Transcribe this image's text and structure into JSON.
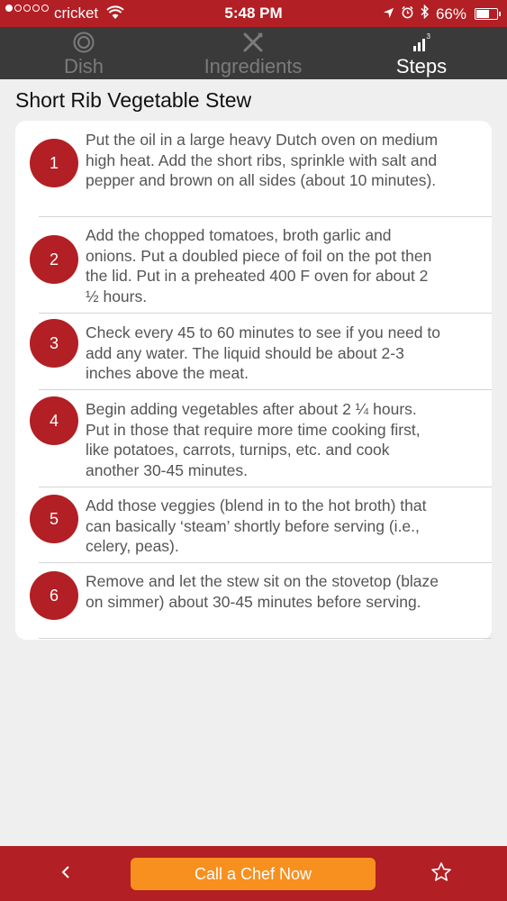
{
  "status_bar": {
    "signal_dots_filled": 1,
    "signal_dots_total": 5,
    "carrier": "cricket",
    "time": "5:48 PM",
    "battery": "66%",
    "battery_level": 0.66,
    "icons": [
      "signal-icon",
      "wifi-icon",
      "location-arrow-icon",
      "alarm-clock-icon",
      "bluetooth-icon",
      "battery-icon"
    ]
  },
  "tabs": [
    {
      "label": "Dish",
      "icon": "dish-plate-icon",
      "active": false
    },
    {
      "label": "Ingredients",
      "icon": "utensils-icon",
      "active": false
    },
    {
      "label": "Steps",
      "icon": "steps-bars-icon",
      "icon_text": "3",
      "active": true
    }
  ],
  "recipe": {
    "title": "Short Rib Vegetable Stew",
    "steps": [
      {
        "number": "1",
        "lines": [
          "Put the oil in a large heavy Dutch oven on medium",
          "high heat. Add the short ribs, sprinkle with salt and",
          "pepper and brown on all sides (about 10 minutes)."
        ]
      },
      {
        "number": "2",
        "lines": [
          "Add the chopped tomatoes, broth garlic and",
          "onions. Put a doubled piece of foil on the pot then",
          "the lid. Put in a preheated 400 F oven for about 2",
          "½ hours."
        ]
      },
      {
        "number": "3",
        "lines": [
          "Check every 45 to 60 minutes to see if you need to",
          "add any water. The liquid should be about 2-3",
          "inches above the meat."
        ]
      },
      {
        "number": "4",
        "lines": [
          "Begin adding vegetables after about 2 ¼ hours.",
          "Put in those that require more time cooking first,",
          "like potatoes, carrots, turnips, etc. and cook",
          "another 30-45 minutes."
        ]
      },
      {
        "number": "5",
        "lines": [
          "Add those veggies (blend in to the hot broth) that",
          "can basically ‘steam’ shortly before serving (i.e.,",
          "celery, peas)."
        ]
      },
      {
        "number": "6",
        "lines": [
          "Remove and let the stew sit on the stovetop (blaze",
          "on simmer) about 30-45 minutes before serving."
        ]
      }
    ]
  },
  "bottom_bar": {
    "back_icon": "chevron-left-icon",
    "call_label": "Call a Chef Now",
    "favorite_icon": "star-icon"
  },
  "colors": {
    "brand_red": "#b21f24",
    "tab_bar": "#3a3a3a",
    "call_button": "#f7901e"
  }
}
